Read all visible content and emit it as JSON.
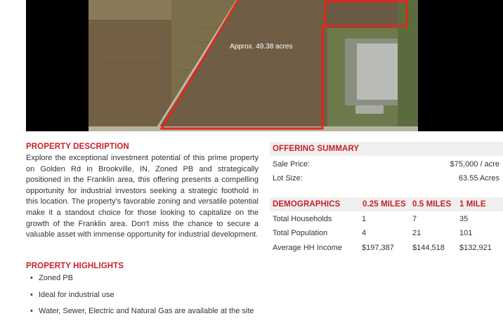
{
  "photo": {
    "acres_label": "Approx. 49.38 acres"
  },
  "description": {
    "title": "PROPERTY DESCRIPTION",
    "body": "Explore the exceptional investment potential of this prime property on Golden Rd in Brookville, IN. Zoned PB and strategically positioned in the Franklin area, this offering presents a compelling opportunity for industrial investors seeking a strategic foothold in this location. The property's favorable zoning and versatile potential make it a standout choice for those looking to capitalize on the growth of the Franklin area. Don't miss the chance to secure a valuable asset with immense opportunity for industrial development."
  },
  "highlights": {
    "title": "PROPERTY HIGHLIGHTS",
    "items": [
      "Zoned PB",
      "Ideal for industrial use",
      "Water, Sewer, Electric and Natural Gas are available at the site"
    ]
  },
  "offering": {
    "title": "OFFERING SUMMARY",
    "rows": [
      {
        "label": "Sale Price:",
        "value": "$75,000 / acre"
      },
      {
        "label": "Lot Size:",
        "value": "63.55 Acres"
      }
    ]
  },
  "demographics": {
    "title": "DEMOGRAPHICS",
    "columns": [
      "0.25 MILES",
      "0.5 MILES",
      "1 MILE"
    ],
    "rows": [
      {
        "label": "Total Households",
        "values": [
          "1",
          "7",
          "35"
        ]
      },
      {
        "label": "Total Population",
        "values": [
          "4",
          "21",
          "101"
        ]
      },
      {
        "label": "Average HH Income",
        "values": [
          "$197,387",
          "$144,518",
          "$132,921"
        ]
      }
    ]
  },
  "colors": {
    "accent_red": "#c8202a",
    "header_bg": "#efefef"
  }
}
